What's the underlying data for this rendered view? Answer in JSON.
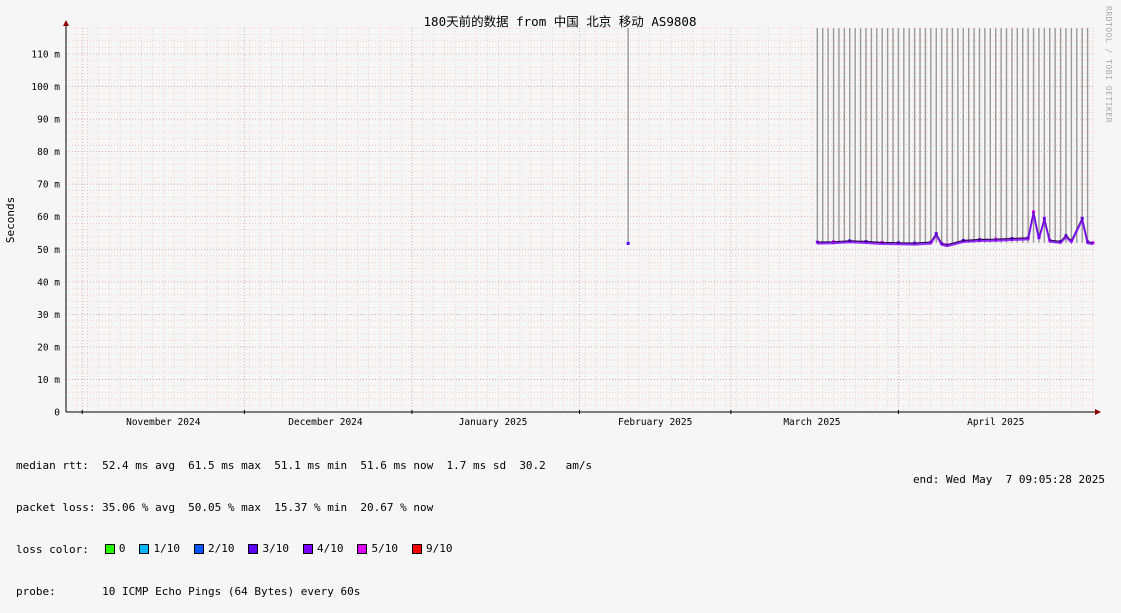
{
  "watermark": "RRDTOOL / TOBI OETIKER",
  "chart_data": {
    "type": "line",
    "title": "180天前的数据 from 中国 北京 移动 AS9808",
    "ylabel": "Seconds",
    "ylim": [
      0,
      0.118
    ],
    "yticks": [
      {
        "v": 0,
        "label": "0"
      },
      {
        "v": 0.01,
        "label": "10 m"
      },
      {
        "v": 0.02,
        "label": "20 m"
      },
      {
        "v": 0.03,
        "label": "30 m"
      },
      {
        "v": 0.04,
        "label": "40 m"
      },
      {
        "v": 0.05,
        "label": "50 m"
      },
      {
        "v": 0.06,
        "label": "60 m"
      },
      {
        "v": 0.07,
        "label": "70 m"
      },
      {
        "v": 0.08,
        "label": "80 m"
      },
      {
        "v": 0.09,
        "label": "90 m"
      },
      {
        "v": 0.1,
        "label": "100 m"
      },
      {
        "v": 0.11,
        "label": "110 m"
      }
    ],
    "xlim": [
      "2024-10-29",
      "2025-05-07"
    ],
    "xticks": [
      {
        "date": "2024-11-01",
        "label": "November 2024"
      },
      {
        "date": "2024-12-01",
        "label": "December 2024"
      },
      {
        "date": "2025-01-01",
        "label": "January 2025"
      },
      {
        "date": "2025-02-01",
        "label": "February 2025"
      },
      {
        "date": "2025-03-01",
        "label": "March 2025"
      },
      {
        "date": "2025-04-01",
        "label": "April 2025"
      }
    ],
    "grid": true,
    "median": [
      {
        "date": "2025-02-10",
        "v": 0.0518
      },
      {
        "date": "2025-03-17",
        "v": 0.0522
      },
      {
        "date": "2025-03-20",
        "v": 0.0523
      },
      {
        "date": "2025-03-23",
        "v": 0.0526
      },
      {
        "date": "2025-03-26",
        "v": 0.0524
      },
      {
        "date": "2025-03-29",
        "v": 0.0521
      },
      {
        "date": "2025-04-01",
        "v": 0.052
      },
      {
        "date": "2025-04-04",
        "v": 0.0519
      },
      {
        "date": "2025-04-07",
        "v": 0.0522
      },
      {
        "date": "2025-04-08",
        "v": 0.0548
      },
      {
        "date": "2025-04-09",
        "v": 0.0518
      },
      {
        "date": "2025-04-10",
        "v": 0.0514
      },
      {
        "date": "2025-04-13",
        "v": 0.0527
      },
      {
        "date": "2025-04-16",
        "v": 0.053
      },
      {
        "date": "2025-04-19",
        "v": 0.0531
      },
      {
        "date": "2025-04-22",
        "v": 0.0533
      },
      {
        "date": "2025-04-25",
        "v": 0.0535
      },
      {
        "date": "2025-04-26",
        "v": 0.0615
      },
      {
        "date": "2025-04-27",
        "v": 0.0536
      },
      {
        "date": "2025-04-28",
        "v": 0.0595
      },
      {
        "date": "2025-04-29",
        "v": 0.0528
      },
      {
        "date": "2025-05-01",
        "v": 0.0524
      },
      {
        "date": "2025-05-02",
        "v": 0.0542
      },
      {
        "date": "2025-05-03",
        "v": 0.0526
      },
      {
        "date": "2025-05-05",
        "v": 0.0595
      },
      {
        "date": "2025-05-06",
        "v": 0.0523
      },
      {
        "date": "2025-05-07",
        "v": 0.052
      }
    ],
    "loss_markers": [
      {
        "date": "2025-02-10"
      },
      {
        "date": "2025-03-17"
      },
      {
        "date": "2025-03-18"
      },
      {
        "date": "2025-03-19"
      },
      {
        "date": "2025-03-20"
      },
      {
        "date": "2025-03-21"
      },
      {
        "date": "2025-03-22"
      },
      {
        "date": "2025-03-23"
      },
      {
        "date": "2025-03-24"
      },
      {
        "date": "2025-03-25"
      },
      {
        "date": "2025-03-26"
      },
      {
        "date": "2025-03-27"
      },
      {
        "date": "2025-03-28"
      },
      {
        "date": "2025-03-29"
      },
      {
        "date": "2025-03-30"
      },
      {
        "date": "2025-03-31"
      },
      {
        "date": "2025-04-01"
      },
      {
        "date": "2025-04-02"
      },
      {
        "date": "2025-04-03"
      },
      {
        "date": "2025-04-04"
      },
      {
        "date": "2025-04-05"
      },
      {
        "date": "2025-04-06"
      },
      {
        "date": "2025-04-07"
      },
      {
        "date": "2025-04-08"
      },
      {
        "date": "2025-04-09"
      },
      {
        "date": "2025-04-10"
      },
      {
        "date": "2025-04-11"
      },
      {
        "date": "2025-04-12"
      },
      {
        "date": "2025-04-13"
      },
      {
        "date": "2025-04-14"
      },
      {
        "date": "2025-04-15"
      },
      {
        "date": "2025-04-16"
      },
      {
        "date": "2025-04-17"
      },
      {
        "date": "2025-04-18"
      },
      {
        "date": "2025-04-19"
      },
      {
        "date": "2025-04-20"
      },
      {
        "date": "2025-04-21"
      },
      {
        "date": "2025-04-22"
      },
      {
        "date": "2025-04-23"
      },
      {
        "date": "2025-04-24"
      },
      {
        "date": "2025-04-25"
      },
      {
        "date": "2025-04-26"
      },
      {
        "date": "2025-04-27"
      },
      {
        "date": "2025-04-28"
      },
      {
        "date": "2025-04-29"
      },
      {
        "date": "2025-04-30"
      },
      {
        "date": "2025-05-01"
      },
      {
        "date": "2025-05-02"
      },
      {
        "date": "2025-05-03"
      },
      {
        "date": "2025-05-04"
      },
      {
        "date": "2025-05-05"
      },
      {
        "date": "2025-05-06"
      }
    ],
    "colors": {
      "background": "#f6f6f6",
      "grid_minor": "#e8b8b8",
      "grid_major": "#d8a0a0",
      "axis": "#000000",
      "arrow": "#8b0000",
      "smoke": "#999999",
      "median": "#2a0050"
    }
  },
  "stats": {
    "median_rtt": "median rtt:  52.4 ms avg  61.5 ms max  51.1 ms min  51.6 ms now  1.7 ms sd  30.2   am/s",
    "packet_loss": "packet loss: 35.06 % avg  50.05 % max  15.37 % min  20.67 % now",
    "loss_color_label": "loss color:",
    "loss_legend": [
      {
        "label": "0",
        "color": "#26ff00"
      },
      {
        "label": "1/10",
        "color": "#00b8ff"
      },
      {
        "label": "2/10",
        "color": "#0059ff"
      },
      {
        "label": "3/10",
        "color": "#5e00ff"
      },
      {
        "label": "4/10",
        "color": "#7e00ff"
      },
      {
        "label": "5/10",
        "color": "#dd00ff"
      },
      {
        "label": "9/10",
        "color": "#ff0000"
      }
    ],
    "probe": "probe:       10 ICMP Echo Pings (64 Bytes) every 60s",
    "end": "end: Wed May  7 09:05:28 2025"
  }
}
